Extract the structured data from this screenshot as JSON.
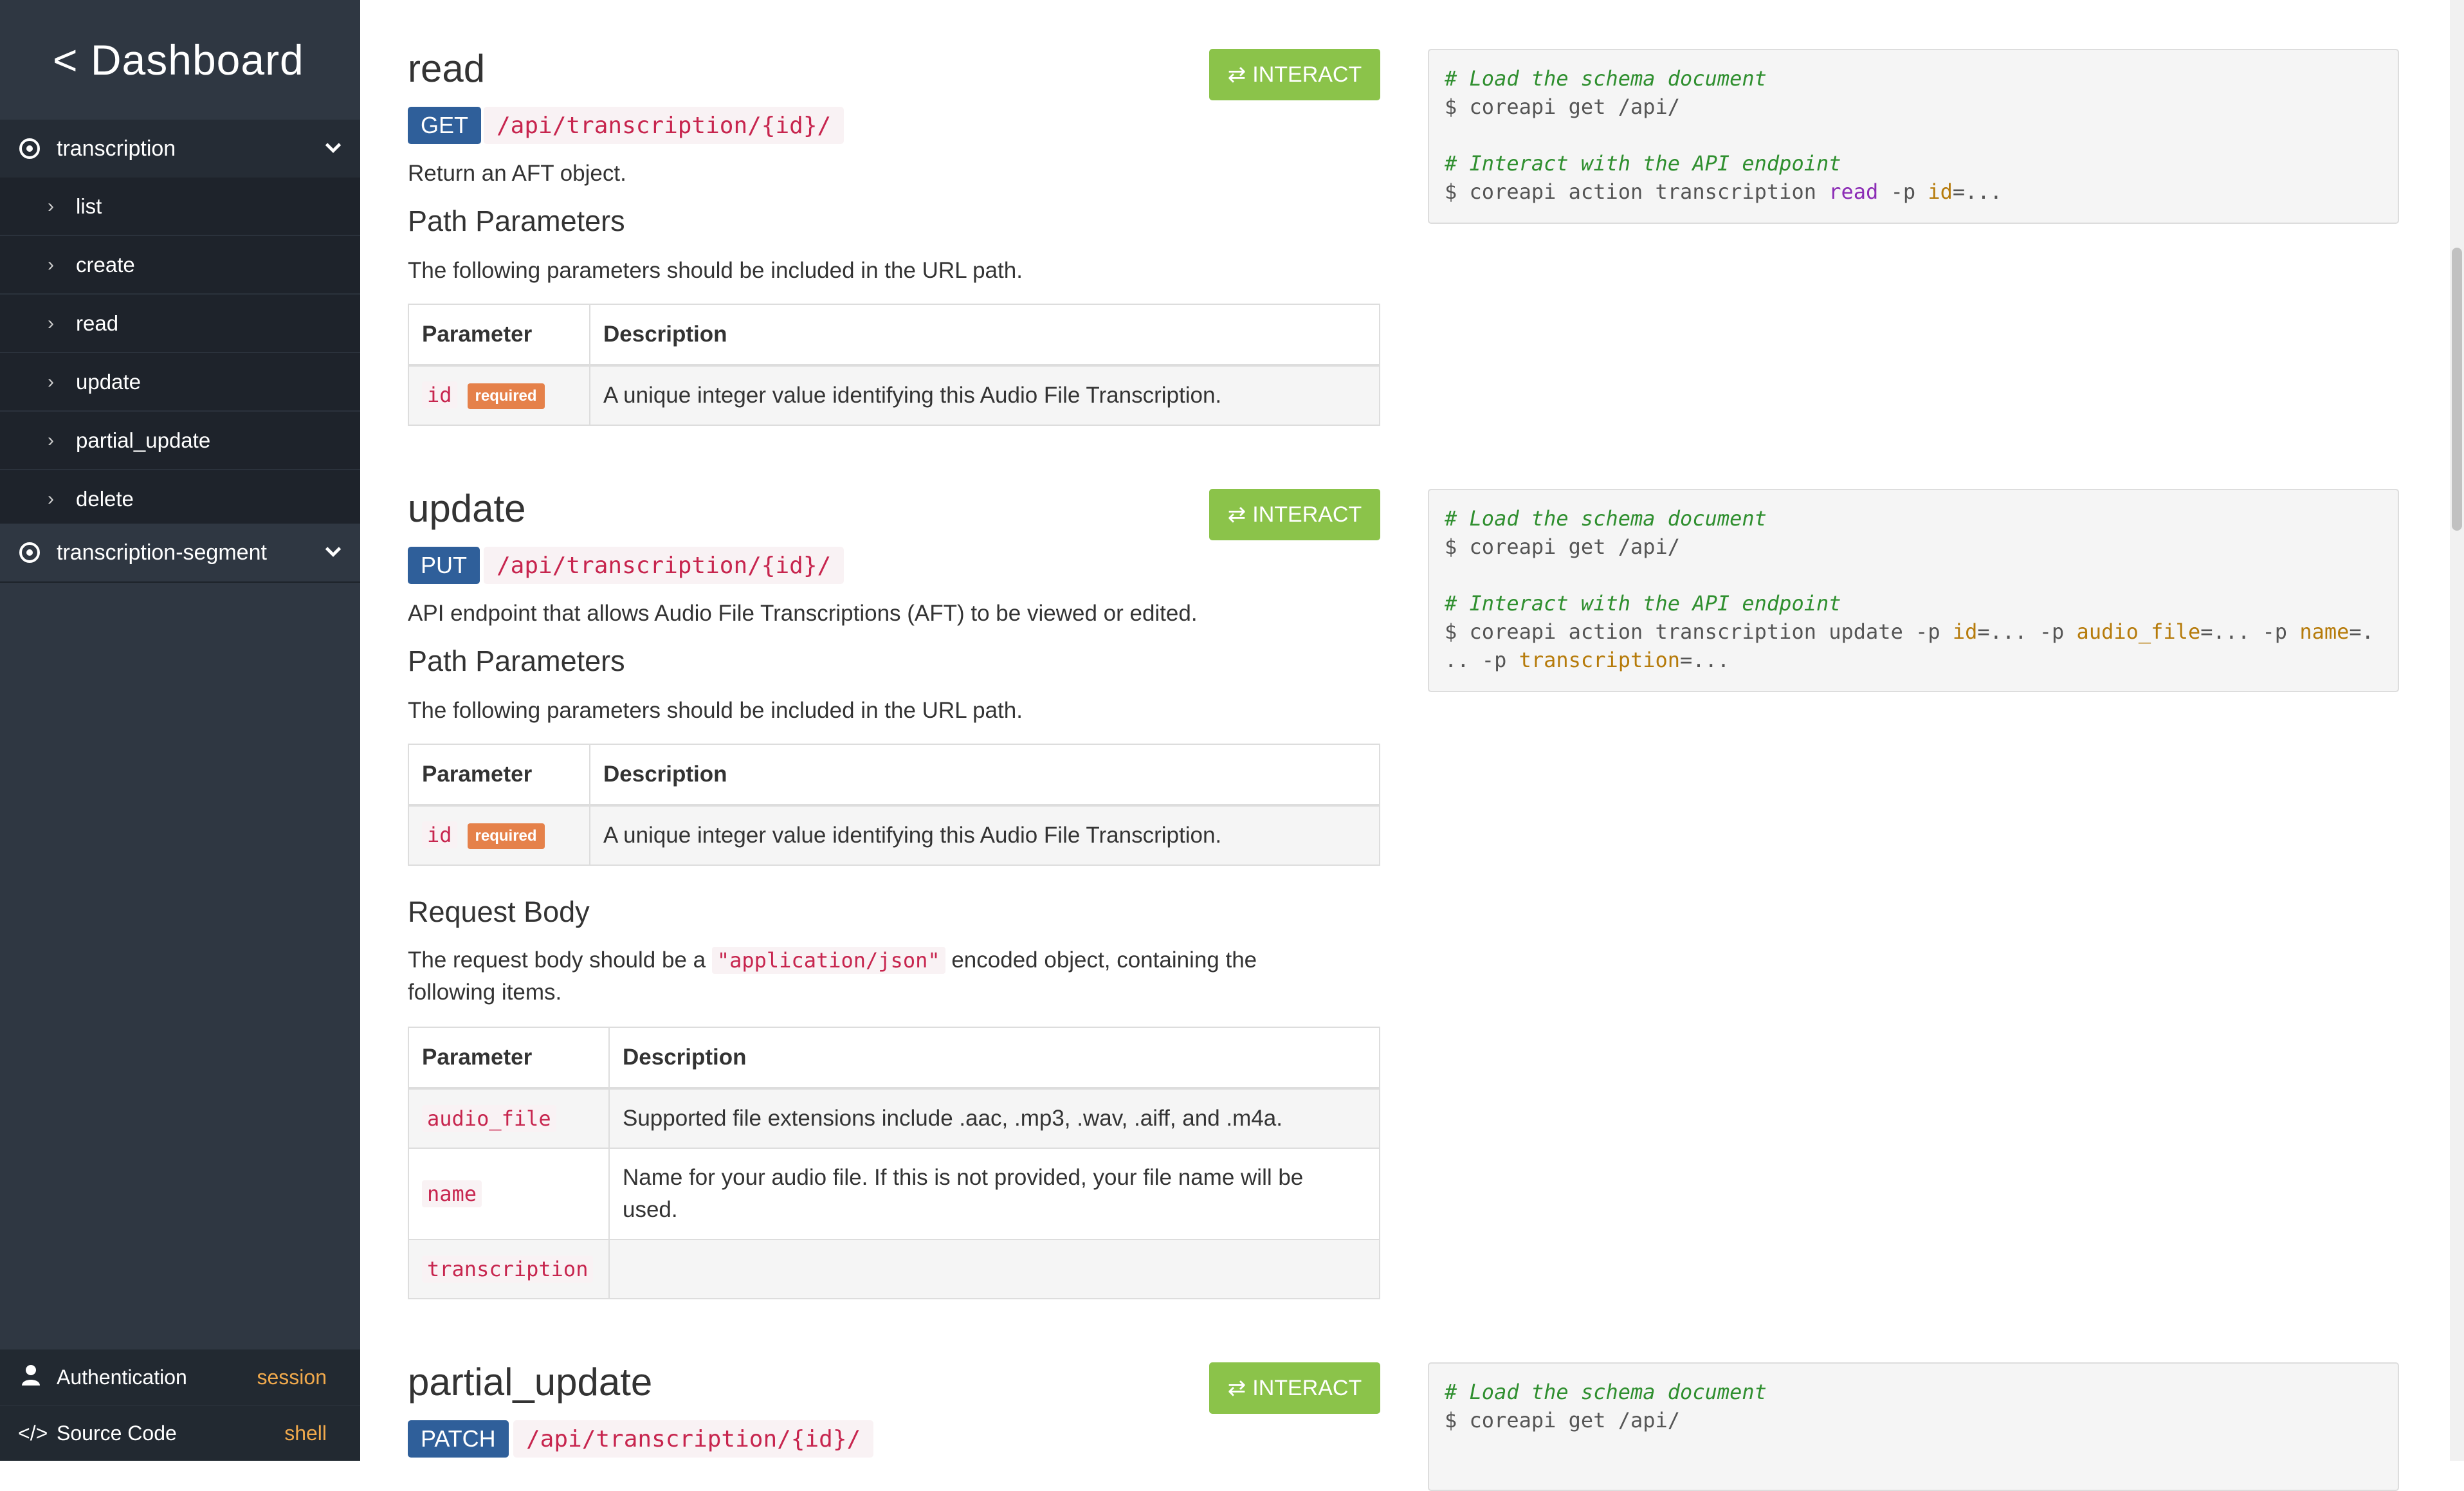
{
  "sidebar": {
    "brand": "< Dashboard",
    "groups": [
      {
        "label": "transcription",
        "items": [
          "list",
          "create",
          "read",
          "update",
          "partial_update",
          "delete"
        ]
      },
      {
        "label": "transcription-segment"
      }
    ],
    "footer": {
      "auth_label": "Authentication",
      "auth_value": "session",
      "source_label": "Source Code",
      "source_value": "shell"
    }
  },
  "interact_label": "INTERACT",
  "sections": {
    "read": {
      "title": "read",
      "method": "GET",
      "path": "/api/transcription/{id}/",
      "description": "Return an AFT object.",
      "path_params_heading": "Path Parameters",
      "path_params_intro": "The following parameters should be included in the URL path.",
      "table_headers": [
        "Parameter",
        "Description"
      ],
      "params": [
        {
          "name": "id",
          "badge": "required",
          "description": "A unique integer value identifying this Audio File Transcription."
        }
      ],
      "code": {
        "c1": "# Load the schema document",
        "l1": "$ coreapi get /api/",
        "c2": "# Interact with the API endpoint",
        "l2_prefix": "$ coreapi action transcription ",
        "l2_action": "read",
        "l2_p1": " -p ",
        "l2_a1": "id",
        "l2_rest": "=..."
      }
    },
    "update": {
      "title": "update",
      "method": "PUT",
      "path": "/api/transcription/{id}/",
      "description": "API endpoint that allows Audio File Transcriptions (AFT) to be viewed or edited.",
      "path_params_heading": "Path Parameters",
      "path_params_intro": "The following parameters should be included in the URL path.",
      "table_headers": [
        "Parameter",
        "Description"
      ],
      "params": [
        {
          "name": "id",
          "badge": "required",
          "description": "A unique integer value identifying this Audio File Transcription."
        }
      ],
      "request_body_heading": "Request Body",
      "request_body_intro_1": "The request body should be a ",
      "request_body_code": "\"application/json\"",
      "request_body_intro_2": " encoded object, containing the",
      "request_body_intro_3": "following items.",
      "body_headers": [
        "Parameter",
        "Description"
      ],
      "body_params": [
        {
          "name": "audio_file",
          "description": "Supported file extensions include .aac, .mp3, .wav, .aiff, and .m4a."
        },
        {
          "name": "name",
          "description_1": "Name for your audio file. If this is not provided, your file name will be",
          "description_2": "used."
        },
        {
          "name": "transcription",
          "description": ""
        }
      ],
      "code": {
        "c1": "# Load the schema document",
        "l1": "$ coreapi get /api/",
        "c2": "# Interact with the API endpoint",
        "l2_prefix": "$ coreapi action transcription update -p ",
        "a1": "id",
        "s1": "=... -p ",
        "a2": "audio_file",
        "s2": "=... -p ",
        "a3": "name",
        "s3": "=.",
        "l3_prefix": ".. -p ",
        "a4": "transcription",
        "s4": "=..."
      }
    },
    "partial_update": {
      "title": "partial_update",
      "method": "PATCH",
      "path": "/api/transcription/{id}/",
      "code": {
        "c1": "# Load the schema document",
        "l1": "$ coreapi get /api/"
      }
    }
  },
  "colors": {
    "sidebar_bg": "#2f3742",
    "interact_green": "#8bc34a",
    "method_blue": "#2f5f9a",
    "code_red": "#c7254e",
    "required_orange": "#e5814a",
    "footer_value": "#f0a94c"
  }
}
